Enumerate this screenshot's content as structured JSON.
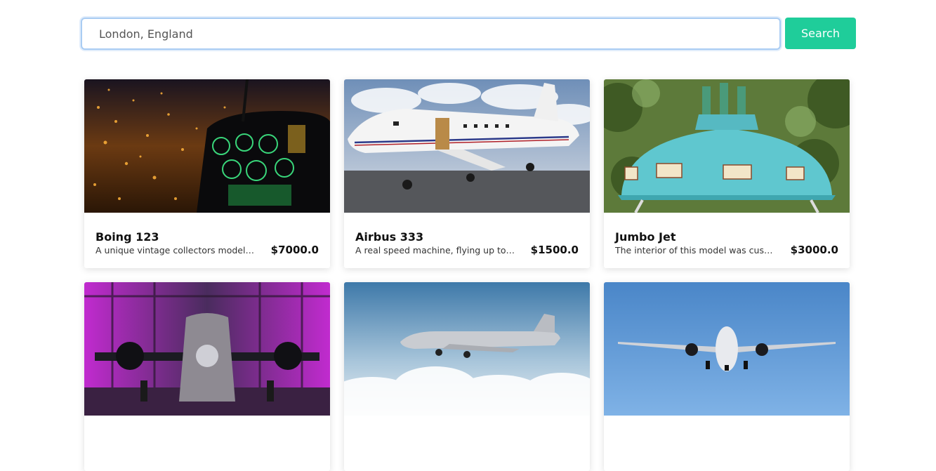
{
  "search": {
    "value": "London, England",
    "button_label": "Search"
  },
  "colors": {
    "accent": "#1fcd9a",
    "input_border": "#a9ccf3"
  },
  "listings": [
    {
      "title": "Boing 123",
      "description": "A unique vintage collectors model t...",
      "price": "$7000.0",
      "image": "helicopter-cockpit-night-city"
    },
    {
      "title": "Airbus 333",
      "description": "A real speed machine, flying up to ...",
      "price": "$1500.0",
      "image": "white-private-jet-on-tarmac"
    },
    {
      "title": "Jumbo Jet",
      "description": "The interior of this model was cust...",
      "price": "$3000.0",
      "image": "turquoise-ufo-house-in-forest"
    },
    {
      "title": "",
      "description": "",
      "price": "",
      "image": "propeller-plane-purple-hangar"
    },
    {
      "title": "",
      "description": "",
      "price": "",
      "image": "vintage-silver-plane-above-clouds"
    },
    {
      "title": "",
      "description": "",
      "price": "",
      "image": "jet-airliner-blue-sky"
    }
  ]
}
